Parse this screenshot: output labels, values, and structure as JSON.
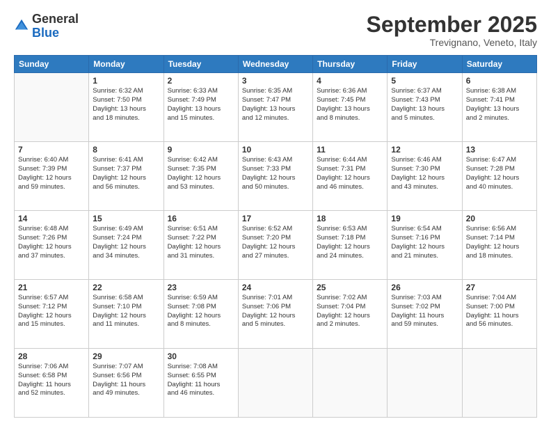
{
  "logo": {
    "general": "General",
    "blue": "Blue"
  },
  "header": {
    "month": "September 2025",
    "location": "Trevignano, Veneto, Italy"
  },
  "days_of_week": [
    "Sunday",
    "Monday",
    "Tuesday",
    "Wednesday",
    "Thursday",
    "Friday",
    "Saturday"
  ],
  "weeks": [
    [
      {
        "day": "",
        "sunrise": "",
        "sunset": "",
        "daylight": ""
      },
      {
        "day": "1",
        "sunrise": "Sunrise: 6:32 AM",
        "sunset": "Sunset: 7:50 PM",
        "daylight": "Daylight: 13 hours and 18 minutes."
      },
      {
        "day": "2",
        "sunrise": "Sunrise: 6:33 AM",
        "sunset": "Sunset: 7:49 PM",
        "daylight": "Daylight: 13 hours and 15 minutes."
      },
      {
        "day": "3",
        "sunrise": "Sunrise: 6:35 AM",
        "sunset": "Sunset: 7:47 PM",
        "daylight": "Daylight: 13 hours and 12 minutes."
      },
      {
        "day": "4",
        "sunrise": "Sunrise: 6:36 AM",
        "sunset": "Sunset: 7:45 PM",
        "daylight": "Daylight: 13 hours and 8 minutes."
      },
      {
        "day": "5",
        "sunrise": "Sunrise: 6:37 AM",
        "sunset": "Sunset: 7:43 PM",
        "daylight": "Daylight: 13 hours and 5 minutes."
      },
      {
        "day": "6",
        "sunrise": "Sunrise: 6:38 AM",
        "sunset": "Sunset: 7:41 PM",
        "daylight": "Daylight: 13 hours and 2 minutes."
      }
    ],
    [
      {
        "day": "7",
        "sunrise": "Sunrise: 6:40 AM",
        "sunset": "Sunset: 7:39 PM",
        "daylight": "Daylight: 12 hours and 59 minutes."
      },
      {
        "day": "8",
        "sunrise": "Sunrise: 6:41 AM",
        "sunset": "Sunset: 7:37 PM",
        "daylight": "Daylight: 12 hours and 56 minutes."
      },
      {
        "day": "9",
        "sunrise": "Sunrise: 6:42 AM",
        "sunset": "Sunset: 7:35 PM",
        "daylight": "Daylight: 12 hours and 53 minutes."
      },
      {
        "day": "10",
        "sunrise": "Sunrise: 6:43 AM",
        "sunset": "Sunset: 7:33 PM",
        "daylight": "Daylight: 12 hours and 50 minutes."
      },
      {
        "day": "11",
        "sunrise": "Sunrise: 6:44 AM",
        "sunset": "Sunset: 7:31 PM",
        "daylight": "Daylight: 12 hours and 46 minutes."
      },
      {
        "day": "12",
        "sunrise": "Sunrise: 6:46 AM",
        "sunset": "Sunset: 7:30 PM",
        "daylight": "Daylight: 12 hours and 43 minutes."
      },
      {
        "day": "13",
        "sunrise": "Sunrise: 6:47 AM",
        "sunset": "Sunset: 7:28 PM",
        "daylight": "Daylight: 12 hours and 40 minutes."
      }
    ],
    [
      {
        "day": "14",
        "sunrise": "Sunrise: 6:48 AM",
        "sunset": "Sunset: 7:26 PM",
        "daylight": "Daylight: 12 hours and 37 minutes."
      },
      {
        "day": "15",
        "sunrise": "Sunrise: 6:49 AM",
        "sunset": "Sunset: 7:24 PM",
        "daylight": "Daylight: 12 hours and 34 minutes."
      },
      {
        "day": "16",
        "sunrise": "Sunrise: 6:51 AM",
        "sunset": "Sunset: 7:22 PM",
        "daylight": "Daylight: 12 hours and 31 minutes."
      },
      {
        "day": "17",
        "sunrise": "Sunrise: 6:52 AM",
        "sunset": "Sunset: 7:20 PM",
        "daylight": "Daylight: 12 hours and 27 minutes."
      },
      {
        "day": "18",
        "sunrise": "Sunrise: 6:53 AM",
        "sunset": "Sunset: 7:18 PM",
        "daylight": "Daylight: 12 hours and 24 minutes."
      },
      {
        "day": "19",
        "sunrise": "Sunrise: 6:54 AM",
        "sunset": "Sunset: 7:16 PM",
        "daylight": "Daylight: 12 hours and 21 minutes."
      },
      {
        "day": "20",
        "sunrise": "Sunrise: 6:56 AM",
        "sunset": "Sunset: 7:14 PM",
        "daylight": "Daylight: 12 hours and 18 minutes."
      }
    ],
    [
      {
        "day": "21",
        "sunrise": "Sunrise: 6:57 AM",
        "sunset": "Sunset: 7:12 PM",
        "daylight": "Daylight: 12 hours and 15 minutes."
      },
      {
        "day": "22",
        "sunrise": "Sunrise: 6:58 AM",
        "sunset": "Sunset: 7:10 PM",
        "daylight": "Daylight: 12 hours and 11 minutes."
      },
      {
        "day": "23",
        "sunrise": "Sunrise: 6:59 AM",
        "sunset": "Sunset: 7:08 PM",
        "daylight": "Daylight: 12 hours and 8 minutes."
      },
      {
        "day": "24",
        "sunrise": "Sunrise: 7:01 AM",
        "sunset": "Sunset: 7:06 PM",
        "daylight": "Daylight: 12 hours and 5 minutes."
      },
      {
        "day": "25",
        "sunrise": "Sunrise: 7:02 AM",
        "sunset": "Sunset: 7:04 PM",
        "daylight": "Daylight: 12 hours and 2 minutes."
      },
      {
        "day": "26",
        "sunrise": "Sunrise: 7:03 AM",
        "sunset": "Sunset: 7:02 PM",
        "daylight": "Daylight: 11 hours and 59 minutes."
      },
      {
        "day": "27",
        "sunrise": "Sunrise: 7:04 AM",
        "sunset": "Sunset: 7:00 PM",
        "daylight": "Daylight: 11 hours and 56 minutes."
      }
    ],
    [
      {
        "day": "28",
        "sunrise": "Sunrise: 7:06 AM",
        "sunset": "Sunset: 6:58 PM",
        "daylight": "Daylight: 11 hours and 52 minutes."
      },
      {
        "day": "29",
        "sunrise": "Sunrise: 7:07 AM",
        "sunset": "Sunset: 6:56 PM",
        "daylight": "Daylight: 11 hours and 49 minutes."
      },
      {
        "day": "30",
        "sunrise": "Sunrise: 7:08 AM",
        "sunset": "Sunset: 6:55 PM",
        "daylight": "Daylight: 11 hours and 46 minutes."
      },
      {
        "day": "",
        "sunrise": "",
        "sunset": "",
        "daylight": ""
      },
      {
        "day": "",
        "sunrise": "",
        "sunset": "",
        "daylight": ""
      },
      {
        "day": "",
        "sunrise": "",
        "sunset": "",
        "daylight": ""
      },
      {
        "day": "",
        "sunrise": "",
        "sunset": "",
        "daylight": ""
      }
    ]
  ]
}
